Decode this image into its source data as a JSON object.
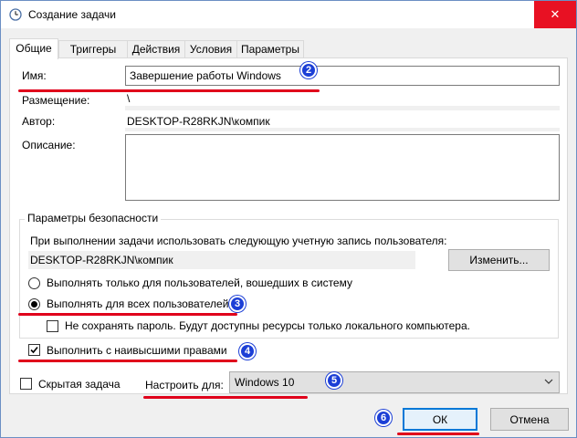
{
  "window": {
    "title": "Создание задачи",
    "close_symbol": "✕"
  },
  "tabs": [
    {
      "label": "Общие",
      "active": true
    },
    {
      "label": "Триггеры"
    },
    {
      "label": "Действия"
    },
    {
      "label": "Условия"
    },
    {
      "label": "Параметры"
    }
  ],
  "general": {
    "name_label": "Имя:",
    "name_value": "Завершение работы Windows",
    "location_label": "Размещение:",
    "location_value": "\\",
    "author_label": "Автор:",
    "author_value": "DESKTOP-R28RKJN\\компик",
    "description_label": "Описание:",
    "description_value": ""
  },
  "security": {
    "title": "Параметры безопасности",
    "account_prompt": "При выполнении задачи использовать следующую учетную запись пользователя:",
    "account_value": "DESKTOP-R28RKJN\\компик",
    "change_button": "Изменить...",
    "radio_logged_on": "Выполнять только для пользователей, вошедших в систему",
    "radio_all_users": "Выполнять для всех пользователей",
    "radio_selected": "all_users",
    "no_store_password": "Не сохранять пароль. Будут доступны ресурсы только локального компьютера.",
    "highest_privileges": "Выполнить с наивысшими правами",
    "highest_checked": true
  },
  "footer": {
    "hidden_label": "Скрытая задача",
    "hidden_checked": false,
    "configure_label": "Настроить для:",
    "configure_value": "Windows 10",
    "ok_button": "ОК",
    "cancel_button": "Отмена"
  },
  "badges": [
    "2",
    "3",
    "4",
    "5",
    "6"
  ],
  "colors": {
    "annotation_red": "#e0001b",
    "badge_blue": "#1c3fd6",
    "close_red": "#e81123",
    "focus_blue": "#0078d7"
  }
}
